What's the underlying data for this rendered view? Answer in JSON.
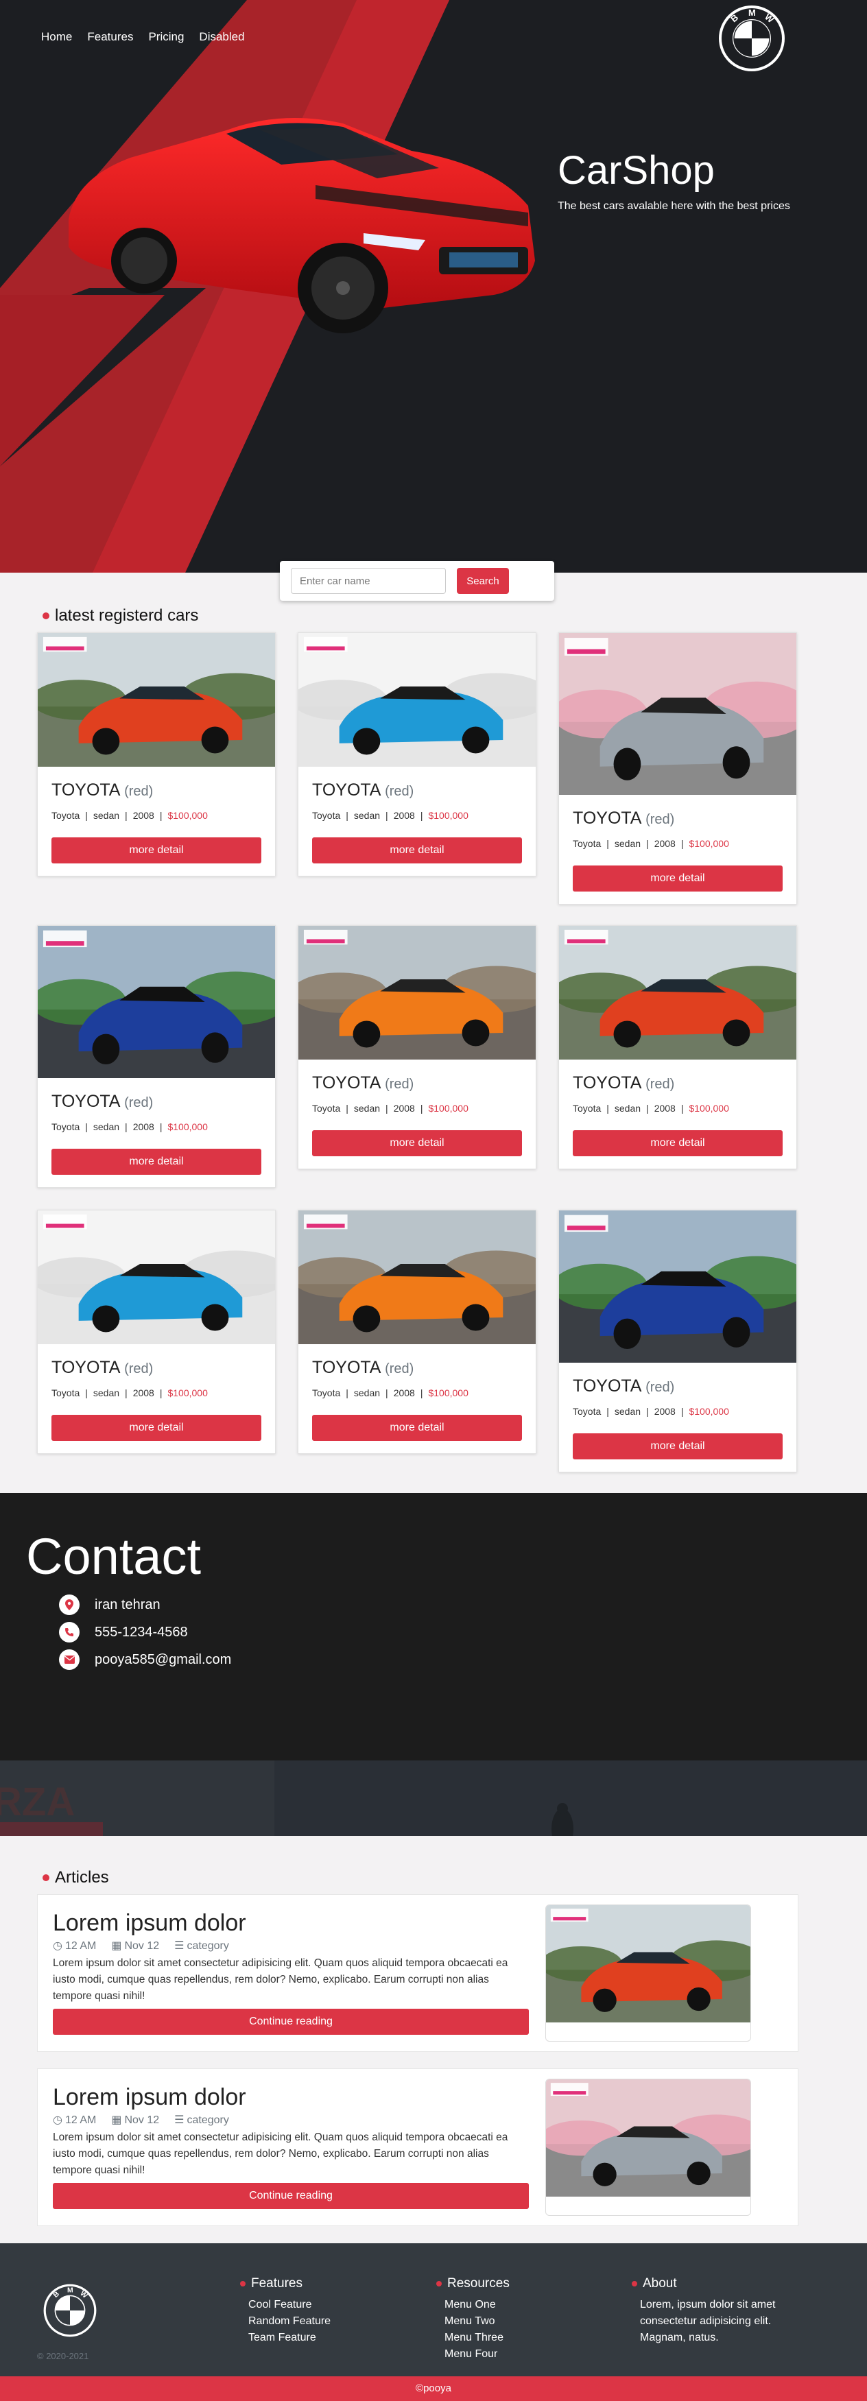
{
  "nav": {
    "items": [
      "Home",
      "Features",
      "Pricing",
      "Disabled"
    ]
  },
  "brand": {
    "logo_letters": [
      "B",
      "M",
      "W"
    ]
  },
  "hero": {
    "title": "CarShop",
    "subtitle": "The best cars avalable here with the best prices"
  },
  "search": {
    "placeholder": "Enter car name",
    "button": "Search"
  },
  "cars_section": {
    "heading": "latest registerd cars"
  },
  "cars": [
    {
      "make": "TOYOTA",
      "color": "(red)",
      "brand": "Toyota",
      "type": "sedan",
      "year": "2008",
      "price": "$100,000",
      "button": "more detail",
      "image": "porsche-orange"
    },
    {
      "make": "TOYOTA",
      "color": "(red)",
      "brand": "Toyota",
      "type": "sedan",
      "year": "2008",
      "price": "$100,000",
      "button": "more detail",
      "image": "bugatti-blue"
    },
    {
      "make": "TOYOTA",
      "color": "(red)",
      "brand": "Toyota",
      "type": "sedan",
      "year": "2008",
      "price": "$100,000",
      "button": "more detail",
      "image": "mustang-silver"
    },
    {
      "make": "TOYOTA",
      "color": "(red)",
      "brand": "Toyota",
      "type": "sedan",
      "year": "2008",
      "price": "$100,000",
      "button": "more detail",
      "image": "shelby-blue"
    },
    {
      "make": "TOYOTA",
      "color": "(red)",
      "brand": "Toyota",
      "type": "sedan",
      "year": "2008",
      "price": "$100,000",
      "button": "more detail",
      "image": "mclaren-street"
    },
    {
      "make": "TOYOTA",
      "color": "(red)",
      "brand": "Toyota",
      "type": "sedan",
      "year": "2008",
      "price": "$100,000",
      "button": "more detail",
      "image": "porsche-orange"
    },
    {
      "make": "TOYOTA",
      "color": "(red)",
      "brand": "Toyota",
      "type": "sedan",
      "year": "2008",
      "price": "$100,000",
      "button": "more detail",
      "image": "bugatti-blue"
    },
    {
      "make": "TOYOTA",
      "color": "(red)",
      "brand": "Toyota",
      "type": "sedan",
      "year": "2008",
      "price": "$100,000",
      "button": "more detail",
      "image": "mclaren-street"
    },
    {
      "make": "TOYOTA",
      "color": "(red)",
      "brand": "Toyota",
      "type": "sedan",
      "year": "2008",
      "price": "$100,000",
      "button": "more detail",
      "image": "shelby-blue"
    }
  ],
  "contact": {
    "title": "Contact",
    "items": [
      {
        "icon": "map-marker-icon",
        "text": "iran tehran"
      },
      {
        "icon": "phone-icon",
        "text": "555-1234-4568"
      },
      {
        "icon": "envelope-icon",
        "text": "pooya585@gmail.com"
      }
    ]
  },
  "articles_section": {
    "heading": "Articles"
  },
  "articles": [
    {
      "title": "Lorem ipsum dolor",
      "time": "12 AM",
      "date": "Nov 12",
      "category": "category",
      "text": "Lorem ipsum dolor sit amet consectetur adipisicing elit. Quam quos aliquid tempora obcaecati ea iusto modi, cumque quas repellendus, rem dolor? Nemo, explicabo. Earum corrupti non alias tempore quasi nihil!",
      "button": "Continue reading",
      "image": "porsche-orange"
    },
    {
      "title": "Lorem ipsum dolor",
      "time": "12 AM",
      "date": "Nov 12",
      "category": "category",
      "text": "Lorem ipsum dolor sit amet consectetur adipisicing elit. Quam quos aliquid tempora obcaecati ea iusto modi, cumque quas repellendus, rem dolor? Nemo, explicabo. Earum corrupti non alias tempore quasi nihil!",
      "button": "Continue reading",
      "image": "mustang-silver"
    }
  ],
  "footer": {
    "copyright": "© 2020-2021",
    "features": {
      "title": "Features",
      "items": [
        "Cool Feature",
        "Random Feature",
        "Team Feature"
      ]
    },
    "resources": {
      "title": "Resources",
      "items": [
        "Menu One",
        "Menu Two",
        "Menu Three",
        "Menu Four"
      ]
    },
    "about": {
      "title": "About",
      "text": "Lorem, ipsum dolor sit amet consectetur adipisicing elit. Magnam, natus."
    },
    "credit": "©pooya"
  },
  "colors": {
    "accent": "#dc3545",
    "hero_bg": "#1c1e22",
    "hero_stripe": "#b8232a",
    "footer_bg": "#343a40",
    "page_bg": "#f3f2f3"
  }
}
